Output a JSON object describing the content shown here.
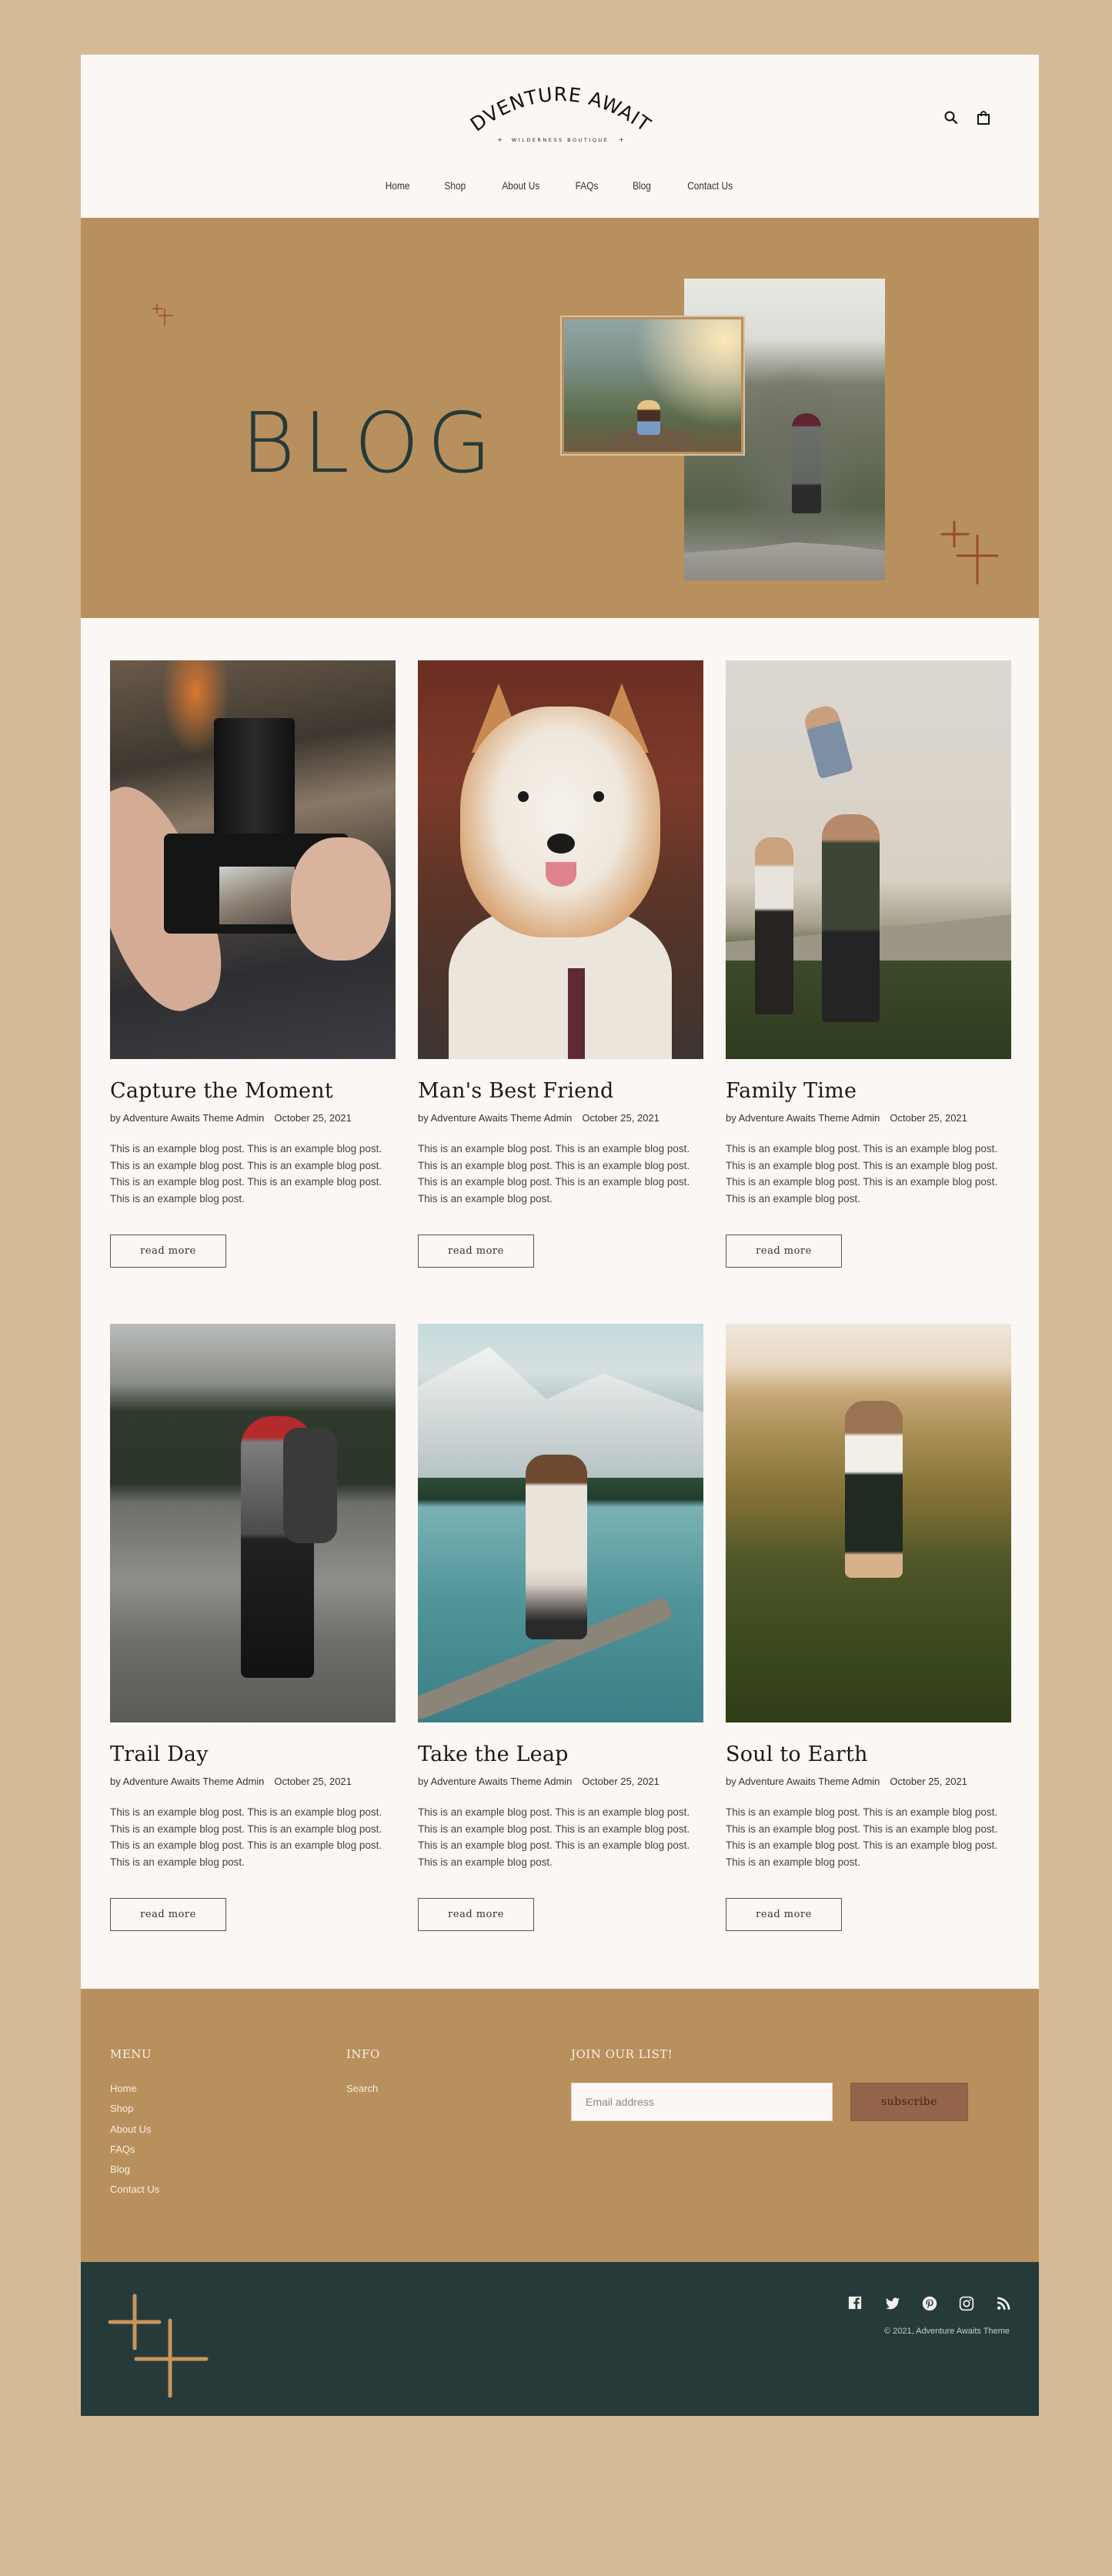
{
  "brand": {
    "name": "ADVENTURE AWAITS",
    "tagline": "WILDERNESS BOUTIQUE",
    "colors": {
      "background": "#d4bb96",
      "surface": "#faf7f4",
      "accent": "#b8905d",
      "dark": "#263a3a",
      "button": "#94654b",
      "sparkle": "#9a4a2e"
    }
  },
  "header": {
    "icons": [
      "search-icon",
      "shopping-bag-icon"
    ],
    "nav": [
      {
        "label": "Home"
      },
      {
        "label": "Shop"
      },
      {
        "label": "About Us"
      },
      {
        "label": "FAQs"
      },
      {
        "label": "Blog"
      },
      {
        "label": "Contact Us"
      }
    ]
  },
  "hero": {
    "title": "BLOG"
  },
  "posts": [
    {
      "title": "Capture the Moment",
      "author": "by Adventure Awaits Theme Admin",
      "date": "October 25, 2021",
      "excerpt": "This is an example blog post. This is an example blog post.  This is an example blog post.  This is an example blog post.  This is an example blog post.  This is an example blog post.  This is an example blog post.",
      "button": "read more",
      "image": "camera-photo"
    },
    {
      "title": "Man's Best Friend",
      "author": "by Adventure Awaits Theme Admin",
      "date": "October 25, 2021",
      "excerpt": "This is an example blog post. This is an example blog post.  This is an example blog post.  This is an example blog post.  This is an example blog post.  This is an example blog post.  This is an example blog post.",
      "button": "read more",
      "image": "dog-photo"
    },
    {
      "title": "Family Time",
      "author": "by Adventure Awaits Theme Admin",
      "date": "October 25, 2021",
      "excerpt": "This is an example blog post. This is an example blog post.  This is an example blog post.  This is an example blog post.  This is an example blog post.  This is an example blog post.  This is an example blog post.",
      "button": "read more",
      "image": "family-photo"
    },
    {
      "title": "Trail Day",
      "author": "by Adventure Awaits Theme Admin",
      "date": "October 25, 2021",
      "excerpt": "This is an example blog post. This is an example blog post.  This is an example blog post.  This is an example blog post.  This is an example blog post.  This is an example blog post.  This is an example blog post.",
      "button": "read more",
      "image": "hiker-photo"
    },
    {
      "title": "Take the Leap",
      "author": "by Adventure Awaits Theme Admin",
      "date": "October 25, 2021",
      "excerpt": "This is an example blog post. This is an example blog post.  This is an example blog post.  This is an example blog post.  This is an example blog post.  This is an example blog post.  This is an example blog post.",
      "button": "read more",
      "image": "lake-photo"
    },
    {
      "title": "Soul to Earth",
      "author": "by Adventure Awaits Theme Admin",
      "date": "October 25, 2021",
      "excerpt": "This is an example blog post. This is an example blog post.  This is an example blog post.  This is an example blog post.  This is an example blog post.  This is an example blog post.  This is an example blog post.",
      "button": "read more",
      "image": "field-photo"
    }
  ],
  "footer": {
    "menu": {
      "heading": "MENU",
      "links": [
        "Home",
        "Shop",
        "About Us",
        "FAQs",
        "Blog",
        "Contact Us"
      ]
    },
    "info": {
      "heading": "INFO",
      "links": [
        "Search"
      ]
    },
    "newsletter": {
      "heading": "JOIN OUR LIST!",
      "placeholder": "Email address",
      "value": "",
      "button": "subscribe"
    },
    "social": [
      "facebook-icon",
      "twitter-icon",
      "pinterest-icon",
      "instagram-icon",
      "rss-icon"
    ],
    "copyright": "© 2021, Adventure Awaits Theme"
  }
}
